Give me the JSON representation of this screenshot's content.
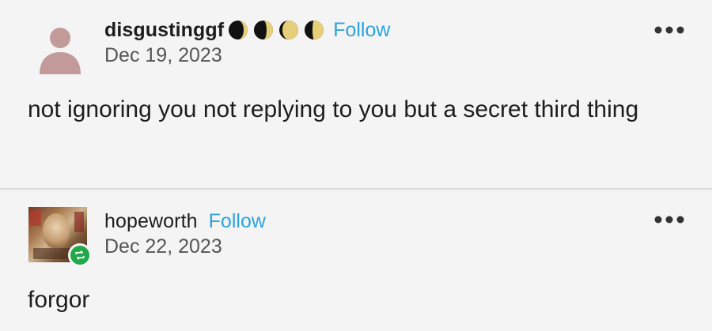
{
  "post1": {
    "username": "disgustinggf",
    "follow_label": "Follow",
    "date": "Dec 19, 2023",
    "body": "not ignoring you not replying to you but a secret third thing",
    "colors": {
      "follow": "#2fa4de",
      "avatar": "#c0a2a2"
    }
  },
  "post2": {
    "username": "hopeworth",
    "follow_label": "Follow",
    "date": "Dec 22, 2023",
    "body": "forgor",
    "colors": {
      "follow": "#2fa4de",
      "reblog_badge": "#21a84a"
    }
  },
  "icons": [
    "default-avatar-icon",
    "moon-badge-icon",
    "more-options-icon",
    "reblog-icon"
  ]
}
